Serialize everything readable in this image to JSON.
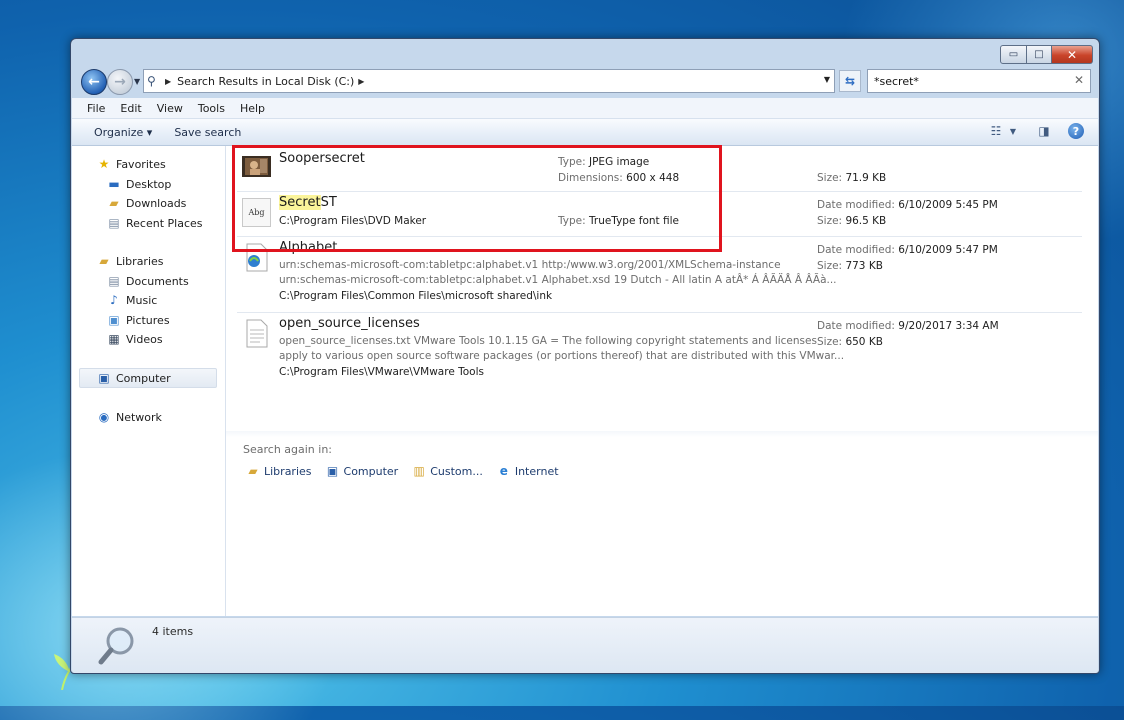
{
  "window": {
    "address_path": "Search Results in Local Disk (C:)",
    "search_query": "*secret*",
    "buttons": {
      "minimize": "▭",
      "maximize": "□",
      "close": "✕"
    }
  },
  "menu": [
    "File",
    "Edit",
    "View",
    "Tools",
    "Help"
  ],
  "command_bar": {
    "organize": "Organize ▾",
    "save_search": "Save search"
  },
  "nav_pane": {
    "favorites": "Favorites",
    "favorites_items": [
      "Desktop",
      "Downloads",
      "Recent Places"
    ],
    "libraries": "Libraries",
    "libraries_items": [
      "Documents",
      "Music",
      "Pictures",
      "Videos"
    ],
    "computer": "Computer",
    "network": "Network"
  },
  "results": [
    {
      "name": "Soopersecret",
      "type_label": "Type:",
      "type_value": "JPEG image",
      "dim_label": "Dimensions:",
      "dim_value": "600 x 448",
      "size_label": "Size:",
      "size_value": "71.9 KB"
    },
    {
      "name_hl": "Secret",
      "name_rest": "ST",
      "path": "C:\\Program Files\\DVD Maker",
      "type_label": "Type:",
      "type_value": "TrueType font file",
      "date_label": "Date modified:",
      "date_value": "6/10/2009 5:45 PM",
      "size_label": "Size:",
      "size_value": "96.5 KB",
      "thumb_text": "Abg"
    },
    {
      "name": "Alphabet",
      "line1": "urn:schemas-microsoft-com:tabletpc:alphabet.v1 http:/www.w3.org/2001/XMLSchema-instance",
      "line2": "urn:schemas-microsoft-com:tabletpc:alphabet.v1 Alphabet.xsd 19 Dutch - All latin A atÂ* Á ÂÃÄÅ Â ÂÃà...",
      "path": "C:\\Program Files\\Common Files\\microsoft shared\\ink",
      "date_label": "Date modified:",
      "date_value": "6/10/2009 5:47 PM",
      "size_label": "Size:",
      "size_value": "773 KB"
    },
    {
      "name": "open_source_licenses",
      "line1": "open_source_licenses.txt VMware Tools 10.1.15 GA = The following copyright statements and licenses",
      "line2": "apply to various open source software packages (or portions thereof) that are distributed with this VMwar...",
      "path": "C:\\Program Files\\VMware\\VMware Tools",
      "date_label": "Date modified:",
      "date_value": "9/20/2017 3:34 AM",
      "size_label": "Size:",
      "size_value": "650 KB"
    }
  ],
  "search_again": {
    "label": "Search again in:",
    "items": [
      "Libraries",
      "Computer",
      "Custom...",
      "Internet"
    ]
  },
  "details": {
    "count": "4 items"
  },
  "colors": {
    "highlight_box": "#e0141e",
    "match_highlight": "#fbf49a"
  }
}
